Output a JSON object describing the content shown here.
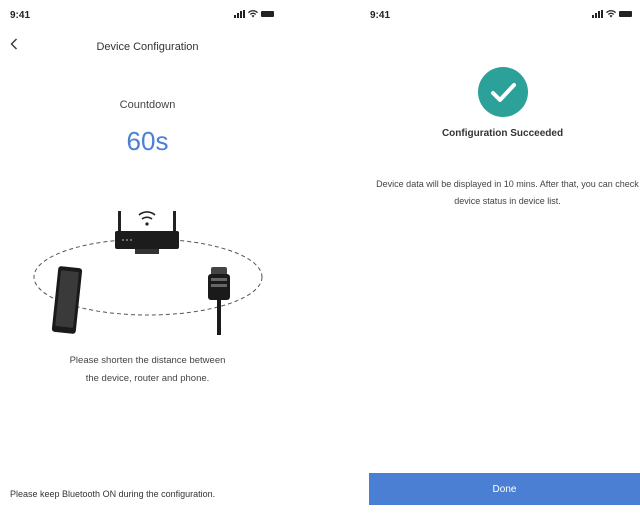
{
  "left_screen": {
    "status_bar": {
      "time": "9:41"
    },
    "nav": {
      "back_icon": "chevron-left-icon",
      "title": "Device Configuration"
    },
    "countdown": {
      "label": "Countdown",
      "value": "60s",
      "color": "#4a80d6"
    },
    "illustration": {
      "icons": [
        "router-icon",
        "wifi-icon",
        "phone-icon",
        "sensor-device-icon"
      ]
    },
    "hint": "Please shorten the distance between\nthe device, router and phone.",
    "footer_note": "Please keep Bluetooth ON during the configuration."
  },
  "right_screen": {
    "status_bar": {
      "time": "9:41"
    },
    "success": {
      "icon": "check-circle-icon",
      "icon_color": "#2ba19a",
      "title": "Configuration Succeeded",
      "description": "Device data will be displayed in 10 mins. After that, you can check device status in device list."
    },
    "done_button": {
      "label": "Done",
      "color": "#4b7fd3"
    }
  }
}
